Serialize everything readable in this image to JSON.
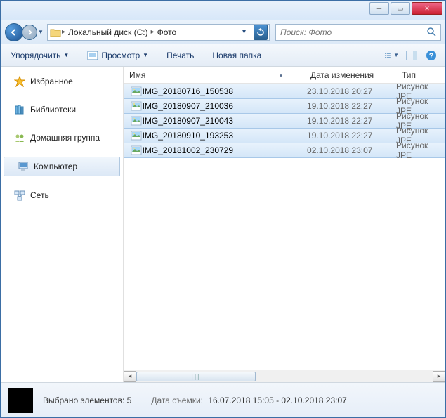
{
  "breadcrumb": {
    "drive": "Локальный диск (C:)",
    "folder": "Фото"
  },
  "search": {
    "placeholder": "Поиск: Фото"
  },
  "toolbar": {
    "organize": "Упорядочить",
    "preview": "Просмотр",
    "print": "Печать",
    "newfolder": "Новая папка"
  },
  "sidebar": {
    "favorites": "Избранное",
    "libraries": "Библиотеки",
    "homegroup": "Домашняя группа",
    "computer": "Компьютер",
    "network": "Сеть"
  },
  "columns": {
    "name": "Имя",
    "date": "Дата изменения",
    "type": "Тип"
  },
  "files": [
    {
      "name": "IMG_20180716_150538",
      "date": "23.10.2018 20:27",
      "type": "Рисунок JPE"
    },
    {
      "name": "IMG_20180907_210036",
      "date": "19.10.2018 22:27",
      "type": "Рисунок JPE"
    },
    {
      "name": "IMG_20180907_210043",
      "date": "19.10.2018 22:27",
      "type": "Рисунок JPE"
    },
    {
      "name": "IMG_20180910_193253",
      "date": "19.10.2018 22:27",
      "type": "Рисунок JPE"
    },
    {
      "name": "IMG_20181002_230729",
      "date": "02.10.2018 23:07",
      "type": "Рисунок JPE"
    }
  ],
  "status": {
    "selected_label": "Выбрано элементов:",
    "selected_count": "5",
    "shot_label": "Дата съемки:",
    "shot_value": "16.07.2018 15:05 - 02.10.2018 23:07"
  }
}
